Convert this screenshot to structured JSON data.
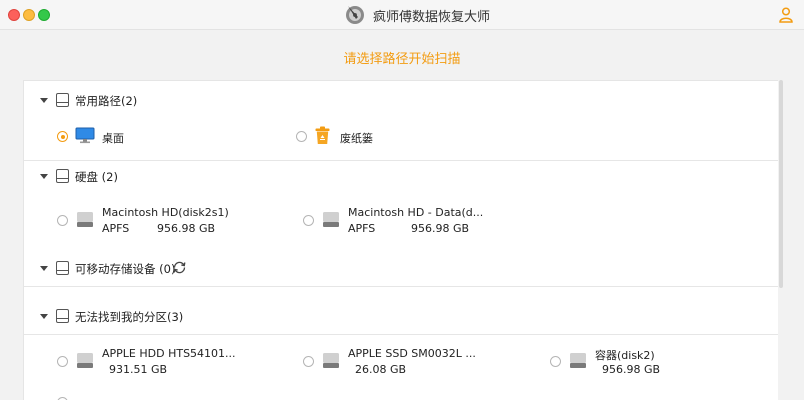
{
  "window": {
    "title": "疯师傅数据恢复大师"
  },
  "instruction": "请选择路径开始扫描",
  "colors": {
    "accent": "#f39c12"
  },
  "sections": {
    "common": {
      "title": "常用路径(2)",
      "items": [
        {
          "label": "桌面",
          "icon": "desktop-icon",
          "selected": true
        },
        {
          "label": "废纸篓",
          "icon": "trash-icon",
          "selected": false
        }
      ]
    },
    "harddisk": {
      "title": "硬盘 (2)",
      "items": [
        {
          "name": "Macintosh HD(disk2s1)",
          "fs": "APFS",
          "size": "956.98 GB"
        },
        {
          "name": "Macintosh HD - Data(d...",
          "fs": "APFS",
          "size": "956.98 GB"
        }
      ]
    },
    "removable": {
      "title": "可移动存储设备 (0)"
    },
    "lost": {
      "title": "无法找到我的分区(3)",
      "items": [
        {
          "name": "APPLE HDD HTS54101...",
          "size": "931.51 GB"
        },
        {
          "name": "APPLE SSD SM0032L ...",
          "size": "26.08 GB"
        },
        {
          "name": "容器(disk2)",
          "size": "956.98 GB"
        }
      ]
    }
  }
}
